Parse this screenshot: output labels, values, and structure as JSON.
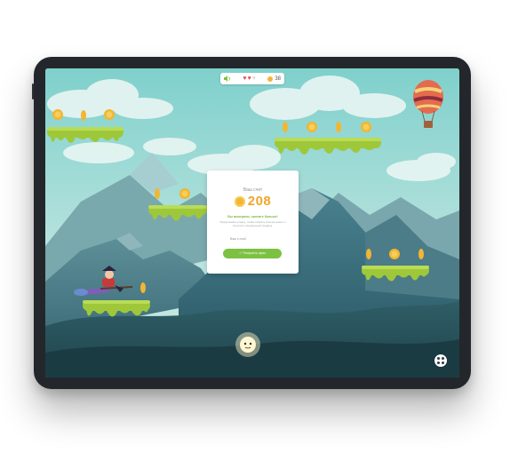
{
  "device": {
    "name": "tablet"
  },
  "hud": {
    "sound_icon": "speaker-icon",
    "lives_total": 3,
    "lives_remaining": 2,
    "heart_colors": [
      "#e5484d",
      "#e5484d",
      "#d9dcde"
    ],
    "coin_count": "38"
  },
  "modal": {
    "title": "Ваш счет",
    "score": "208",
    "headline": "Вы выиграли, скопите больше!",
    "body": "Продолжайте играть, чтобы собрать больше монет и получить специальный подарок.",
    "field_label": "Ваш e-mail",
    "button_label": "✓ Получить приз"
  },
  "colors": {
    "sky": "#b6e0dc",
    "coin": "#f2b632",
    "slime": "#9ec83a",
    "accent_green": "#7dc142",
    "score_orange": "#f0a72a"
  },
  "icons": {
    "menu": "grid-dots-icon",
    "balloon": "hot-air-balloon-icon",
    "character": "witch-on-broom-icon",
    "creature": "glowing-creature-icon"
  }
}
